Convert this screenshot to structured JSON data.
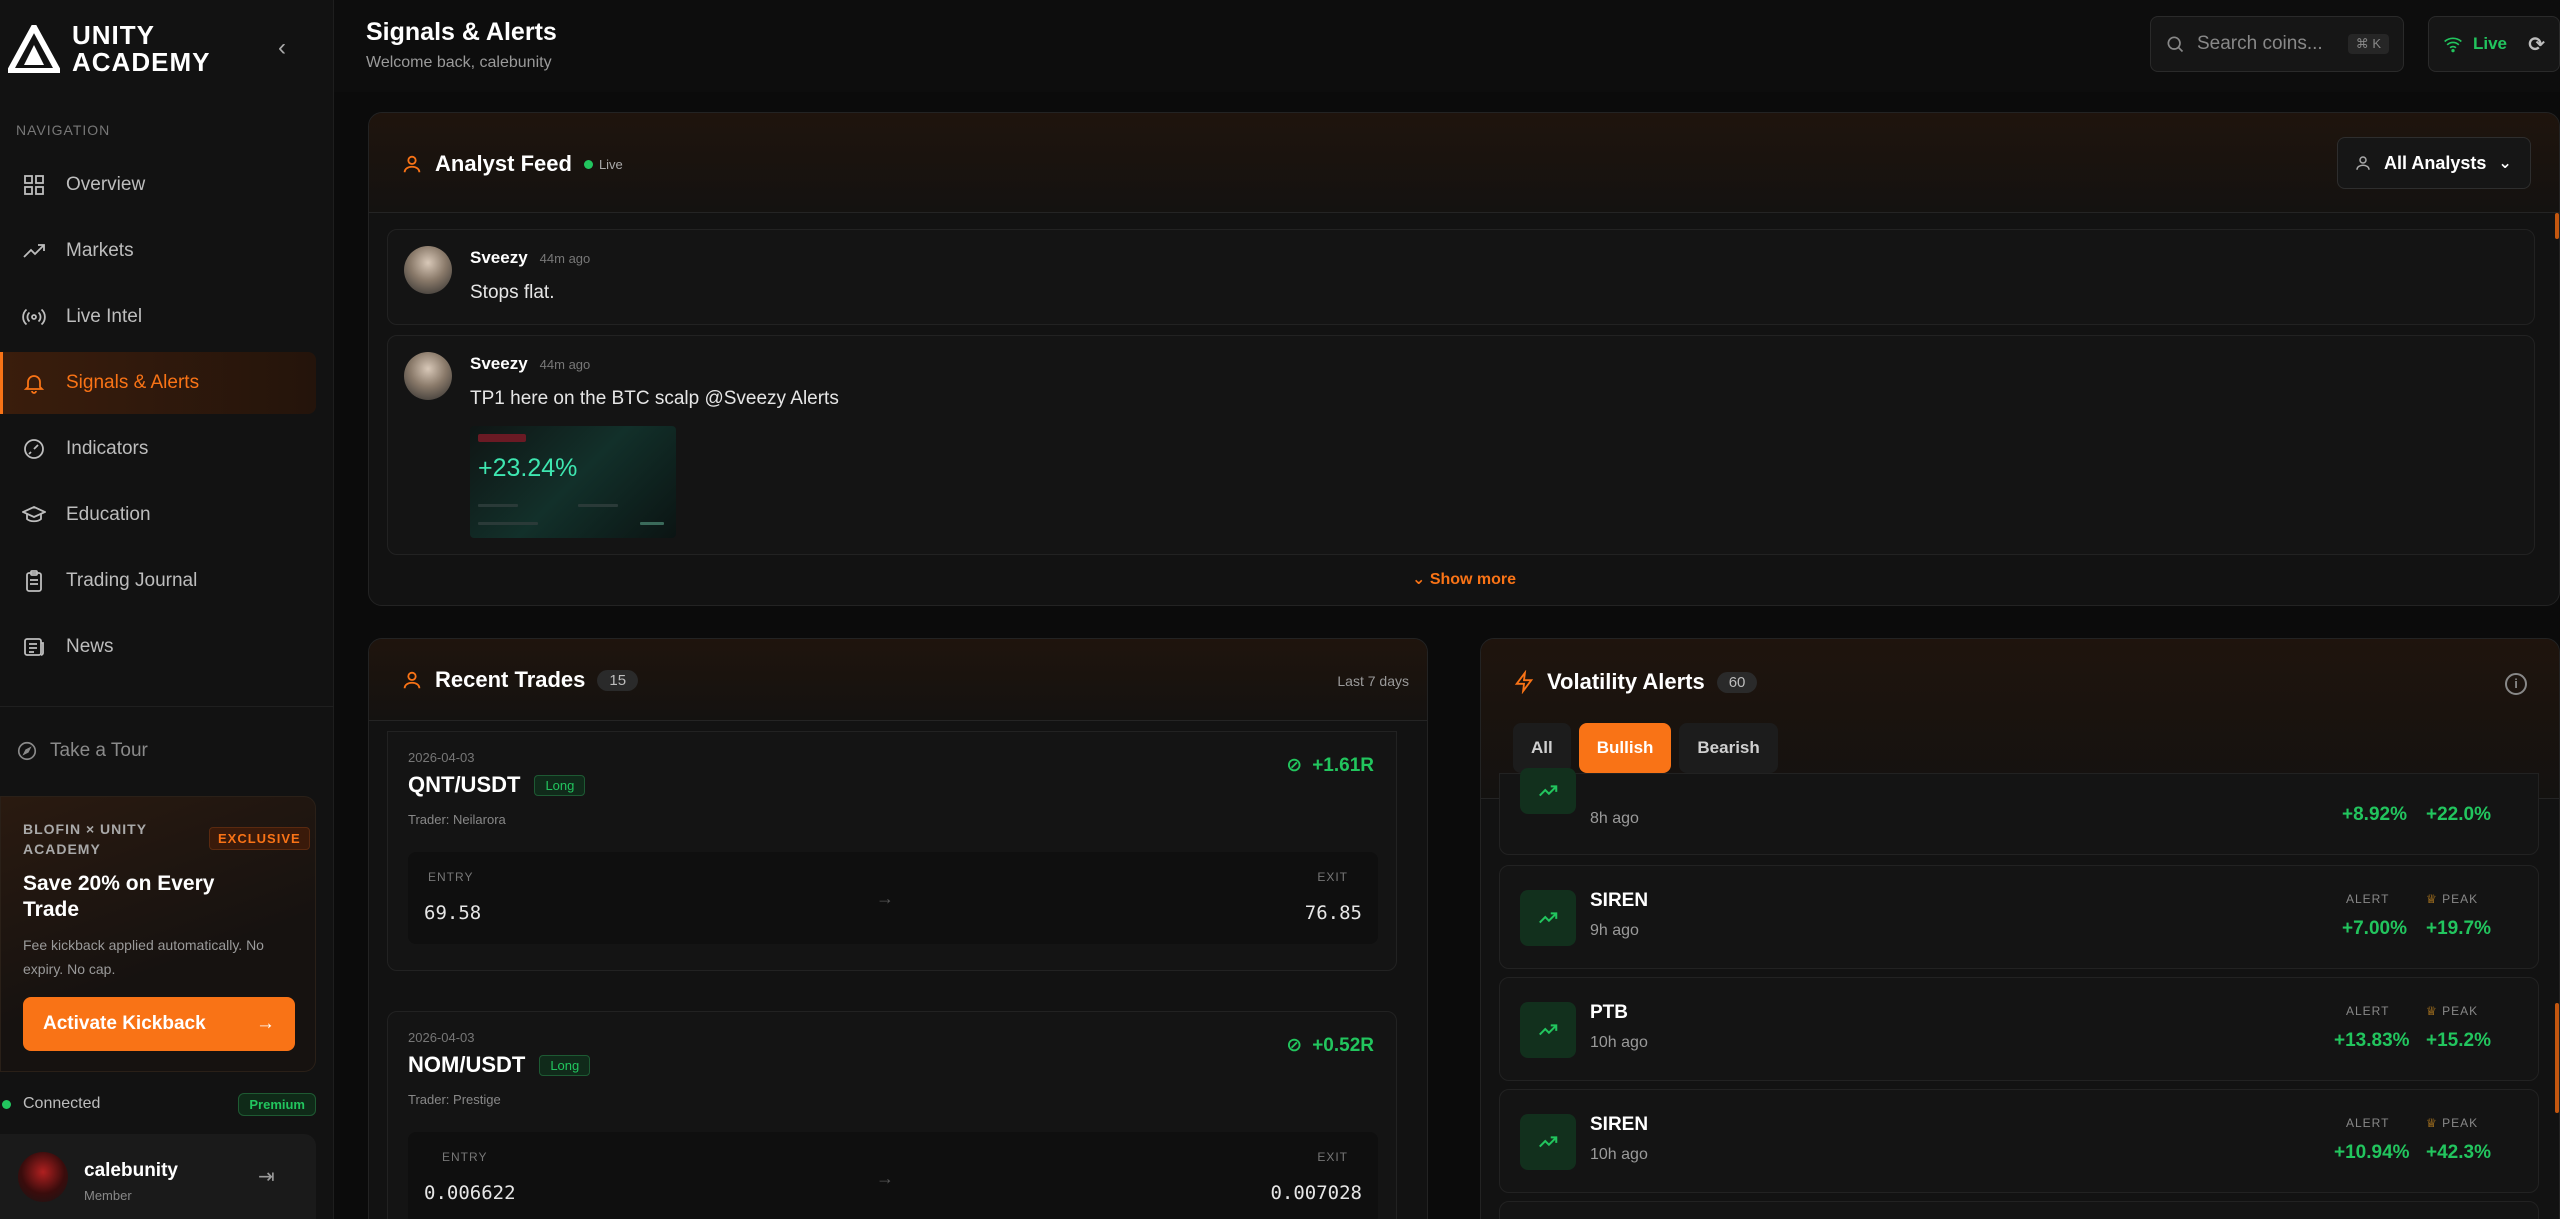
{
  "brand": {
    "line1": "UNITY",
    "line2": "ACADEMY"
  },
  "nav": {
    "label": "NAVIGATION",
    "items": [
      {
        "label": "Overview",
        "icon": "grid-icon"
      },
      {
        "label": "Markets",
        "icon": "trend-up-icon"
      },
      {
        "label": "Live Intel",
        "icon": "broadcast-icon"
      },
      {
        "label": "Signals & Alerts",
        "icon": "bell-icon",
        "active": true
      },
      {
        "label": "Indicators",
        "icon": "gauge-icon"
      },
      {
        "label": "Education",
        "icon": "graduation-cap-icon"
      },
      {
        "label": "Trading Journal",
        "icon": "clipboard-icon"
      },
      {
        "label": "News",
        "icon": "newspaper-icon"
      }
    ],
    "tour": "Take a Tour"
  },
  "promo": {
    "brand": "BLOFIN × UNITY ACADEMY",
    "badge": "EXCLUSIVE",
    "title": "Save 20% on Every Trade",
    "desc": "Fee kickback applied automatically. No expiry. No cap.",
    "cta": "Activate Kickback"
  },
  "status": {
    "connected": "Connected",
    "plan": "Premium"
  },
  "user": {
    "name": "calebunity",
    "role": "Member"
  },
  "header": {
    "title": "Signals & Alerts",
    "subtitle": "Welcome back, calebunity",
    "search_placeholder": "Search coins...",
    "search_shortcut": "⌘ K",
    "live": "Live"
  },
  "feed": {
    "title": "Analyst Feed",
    "live": "Live",
    "filter": "All Analysts",
    "show_more": "Show more",
    "posts": [
      {
        "author": "Sveezy",
        "time": "44m ago",
        "text": "Stops flat."
      },
      {
        "author": "Sveezy",
        "time": "44m ago",
        "text": "TP1 here on the BTC scalp @Sveezy Alerts",
        "image_pct": "+23.24%"
      }
    ]
  },
  "trades": {
    "title": "Recent Trades",
    "count": "15",
    "period": "Last 7 days",
    "entry_label": "ENTRY",
    "exit_label": "EXIT",
    "items": [
      {
        "date": "2026-04-03",
        "pair": "QNT/USDT",
        "side": "Long",
        "trader": "Trader: Neilarora",
        "r": "+1.61R",
        "entry": "69.58",
        "exit": "76.85"
      },
      {
        "date": "2026-04-03",
        "pair": "NOM/USDT",
        "side": "Long",
        "trader": "Trader: Prestige",
        "r": "+0.52R",
        "entry": "0.006622",
        "exit": "0.007028"
      }
    ]
  },
  "volatility": {
    "title": "Volatility Alerts",
    "count": "60",
    "filters": [
      "All",
      "Bullish",
      "Bearish"
    ],
    "active_filter": "Bullish",
    "alert_label": "ALERT",
    "peak_label": "PEAK",
    "items": [
      {
        "symbol": "",
        "time": "8h ago",
        "alert": "+8.92%",
        "peak": "+22.0%"
      },
      {
        "symbol": "SIREN",
        "time": "9h ago",
        "alert": "+7.00%",
        "peak": "+19.7%"
      },
      {
        "symbol": "PTB",
        "time": "10h ago",
        "alert": "+13.83%",
        "peak": "+15.2%"
      },
      {
        "symbol": "SIREN",
        "time": "10h ago",
        "alert": "+10.94%",
        "peak": "+42.3%"
      }
    ]
  },
  "colors": {
    "accent": "#f97316",
    "positive": "#22c55e",
    "background": "#0b0b0b",
    "panel": "#121212"
  }
}
